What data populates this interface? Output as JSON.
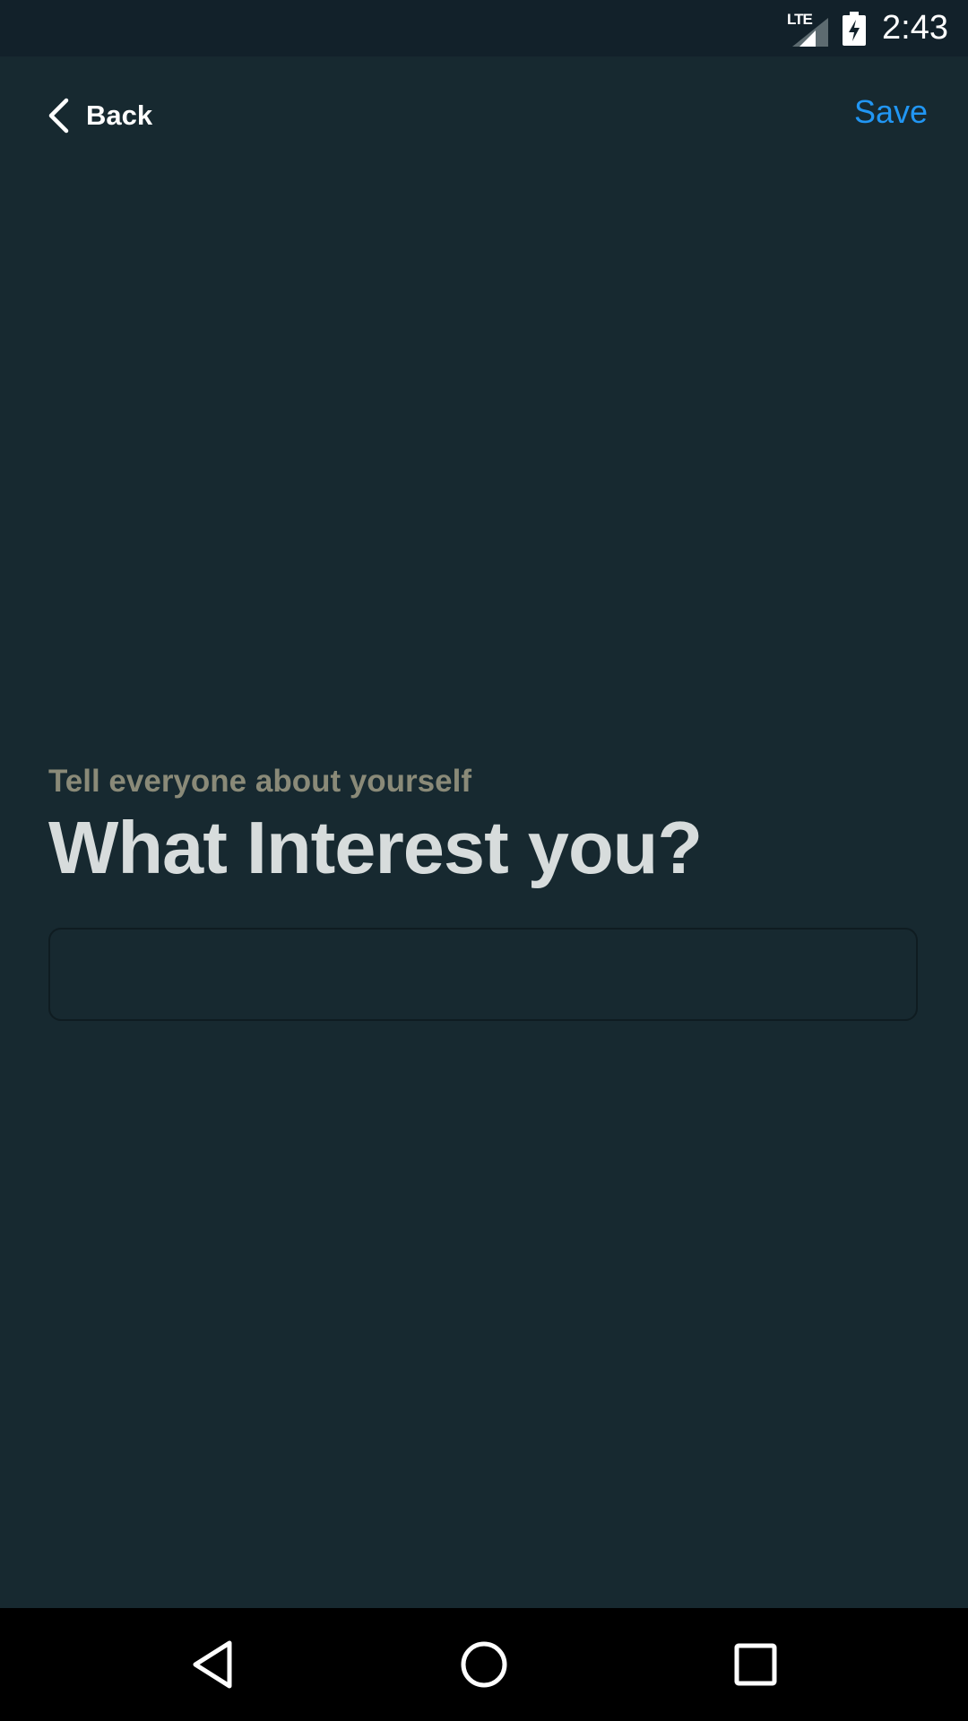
{
  "status_bar": {
    "network": "LTE",
    "time": "2:43"
  },
  "header": {
    "back_label": "Back",
    "save_label": "Save"
  },
  "main": {
    "subtitle": "Tell everyone about yourself",
    "title": "What Interest you?",
    "interests_input": {
      "value": "",
      "placeholder": ""
    }
  },
  "nav_bar": {
    "icons": [
      "nav-back-icon",
      "nav-home-icon",
      "nav-recents-icon"
    ]
  },
  "colors": {
    "background": "#172930",
    "status_bar": "#12212a",
    "accent": "#2196f3",
    "subtitle": "#8a8a78",
    "title": "#d7dcdc"
  }
}
